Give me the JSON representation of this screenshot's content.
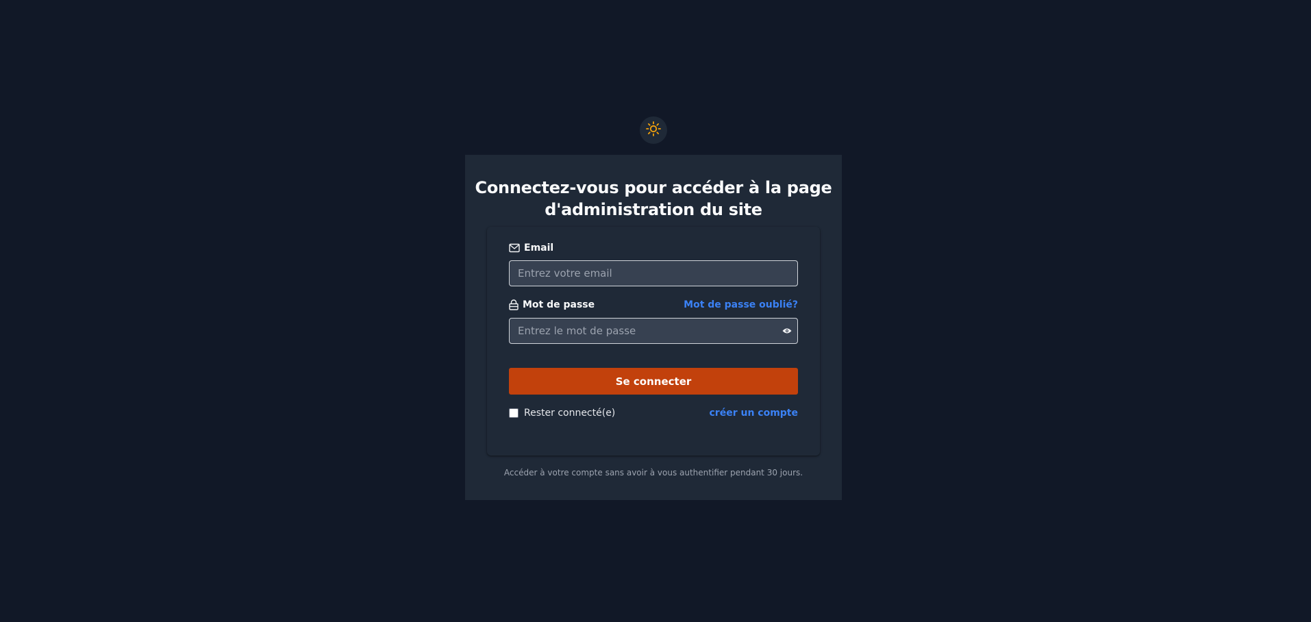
{
  "title": "Connectez-vous pour accéder à la page d'administration du site",
  "theme_toggle_icon": "sun-icon",
  "form": {
    "email": {
      "label": "Email",
      "icon": "envelope-icon",
      "placeholder": "Entrez votre email",
      "value": ""
    },
    "password": {
      "label": "Mot de passe",
      "icon": "lock-icon",
      "placeholder": "Entrez le mot de passe",
      "value": "",
      "forgot_link": "Mot de passe oublié?",
      "toggle_icon": "eye-icon"
    },
    "submit_label": "Se connecter",
    "remember_label": "Rester connecté(e)",
    "remember_checked": false,
    "create_account_link": "créer un compte"
  },
  "footnote": "Accéder à votre compte sans avoir à vous authentifier pendant 30 jours.",
  "colors": {
    "background": "#111827",
    "panel": "#1f2937",
    "accent": "#c2410c",
    "link": "#3b82f6",
    "sun": "#f59e0b"
  }
}
